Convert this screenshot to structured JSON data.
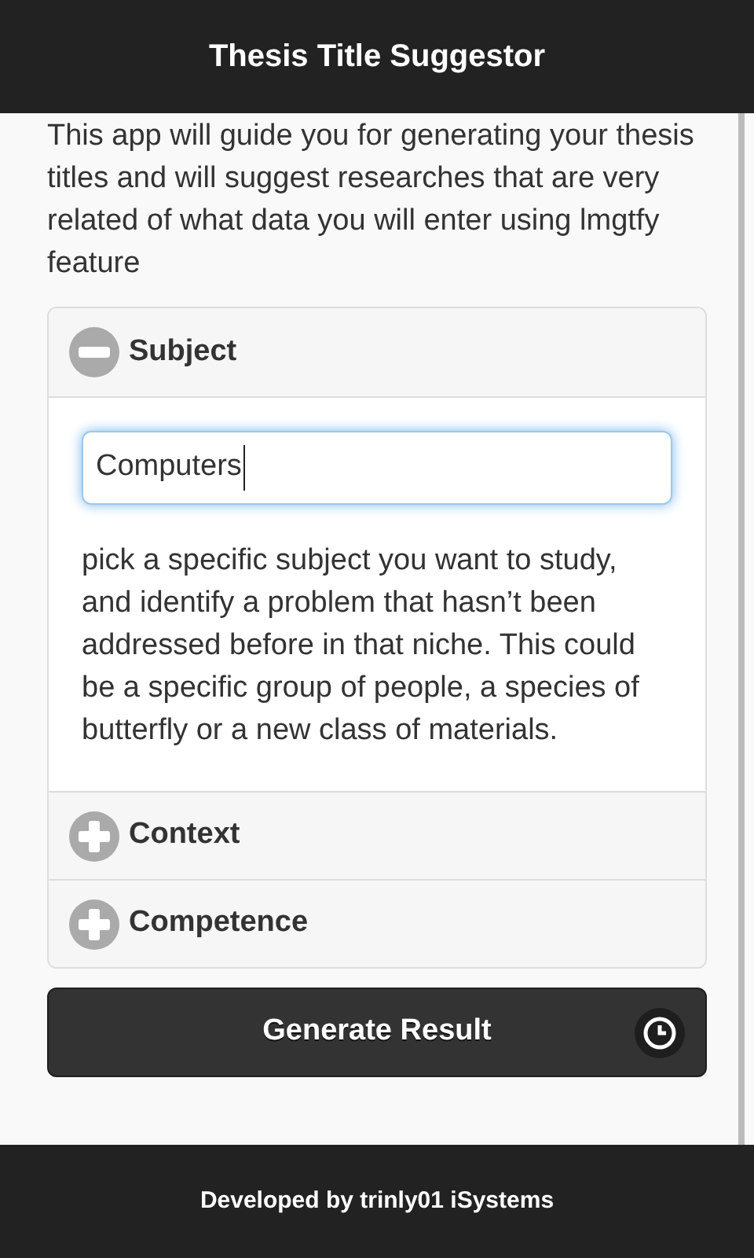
{
  "header": {
    "title": "Thesis Title Suggestor"
  },
  "intro": "This app will guide you for generating your thesis titles and will suggest researches that are very related of what data you will enter using lmgtfy feature",
  "sections": [
    {
      "title": "Subject",
      "expanded": true,
      "field": {
        "value": "Computers"
      },
      "description": "pick a specific subject you want to study, and identify a problem that hasn’t been addressed before in that niche. This could be a specific group of people, a species of butterfly or a new class of materials."
    },
    {
      "title": "Context",
      "expanded": false
    },
    {
      "title": "Competence",
      "expanded": false
    }
  ],
  "generate_button": {
    "label": "Generate Result"
  },
  "footer": {
    "text": "Developed by trinly01 iSystems"
  }
}
